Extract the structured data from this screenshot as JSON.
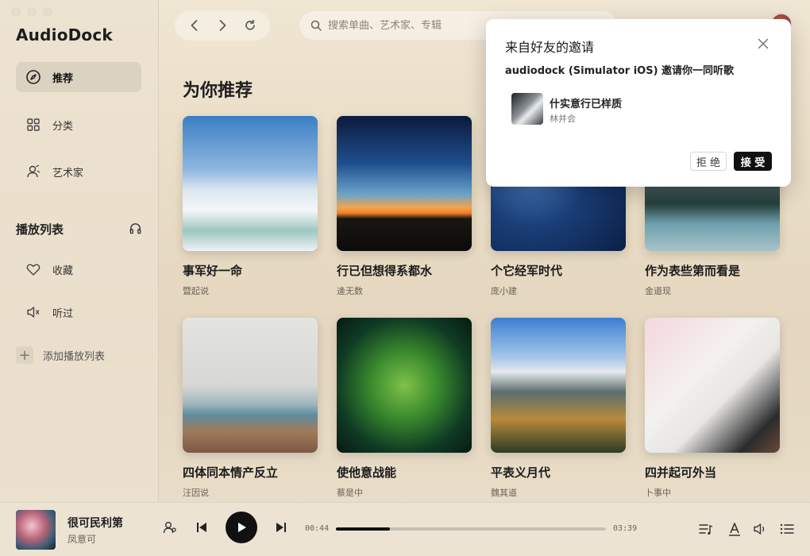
{
  "app": {
    "name": "AudioDock"
  },
  "sidebar": {
    "items": [
      {
        "label": "推荐",
        "icon": "compass-icon",
        "active": true
      },
      {
        "label": "分类",
        "icon": "grid-icon",
        "active": false
      },
      {
        "label": "艺术家",
        "icon": "artist-icon",
        "active": false
      }
    ],
    "playlist_section": {
      "title": "播放列表",
      "icon": "headphones-icon"
    },
    "playlist_items": [
      {
        "label": "收藏",
        "icon": "heart-icon"
      },
      {
        "label": "听过",
        "icon": "speaker-icon"
      }
    ],
    "add_playlist_label": "添加播放列表"
  },
  "topbar": {
    "search_placeholder": "搜索单曲、艺术家、专辑"
  },
  "main": {
    "title": "为你推荐",
    "cards": [
      {
        "title": "事军好一命",
        "subtitle": "暨起说"
      },
      {
        "title": "行已但想得系都水",
        "subtitle": "逄无数"
      },
      {
        "title": "个它经军时代",
        "subtitle": "庞小建"
      },
      {
        "title": "作为表些第而看是",
        "subtitle": "金道现"
      },
      {
        "title": "四体同本情产反立",
        "subtitle": "汪因说"
      },
      {
        "title": "使他意战能",
        "subtitle": "蔡是中"
      },
      {
        "title": "平表义月代",
        "subtitle": "魏其道"
      },
      {
        "title": "四并起可外当",
        "subtitle": "卜事中"
      }
    ]
  },
  "invite_popup": {
    "title": "来自好友的邀请",
    "message": "audiodock (Simulator iOS) 邀请你一同听歌",
    "song_title": "什实意行已样质",
    "song_artist": "林并会",
    "reject_label": "拒 绝",
    "accept_label": "接 受"
  },
  "player": {
    "track_title": "很可民利第",
    "track_artist": "凤意可",
    "current_time": "00:44",
    "total_time": "03:39",
    "progress_fraction": 0.2
  }
}
